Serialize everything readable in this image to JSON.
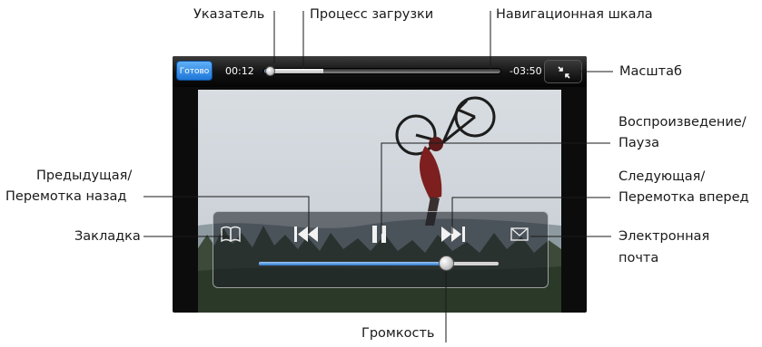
{
  "player": {
    "done_label": "Готово",
    "elapsed": "00:12",
    "remaining": "-03:50",
    "playback_fraction": 0.01,
    "loaded_fraction": 0.25,
    "volume_fraction": 0.78,
    "accent_color": "#2a7bd1"
  },
  "icons": {
    "bookmark": "book-icon",
    "previous": "skip-back-icon",
    "play_pause": "pause-icon",
    "next": "skip-forward-icon",
    "email": "envelope-icon",
    "scale": "shrink-arrows-icon"
  },
  "callouts": {
    "pointer": "Указатель",
    "download_progress": "Процесс загрузки",
    "navigation_bar": "Навигационная шкала",
    "scale": "Масштаб",
    "play_pause_line1": "Воспроизведение/",
    "play_pause_line2": "Пауза",
    "previous_line1": "Предыдущая/",
    "previous_line2": "Перемотка назад",
    "next_line1": "Следующая/",
    "next_line2": "Перемотка вперед",
    "bookmark": "Закладка",
    "email_line1": "Электронная",
    "email_line2": "почта",
    "volume": "Громкость"
  }
}
